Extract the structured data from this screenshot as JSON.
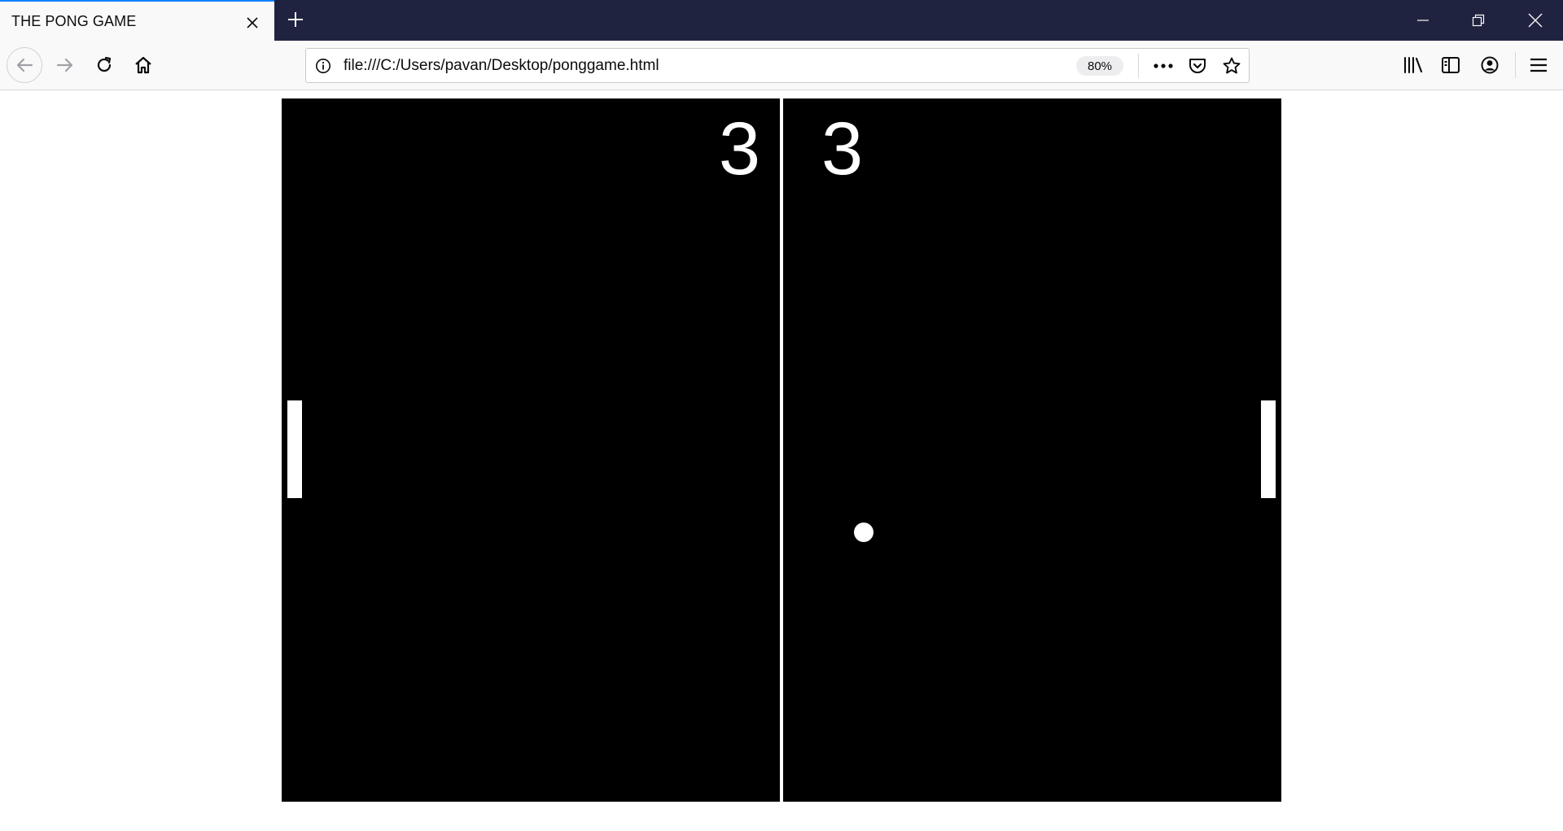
{
  "browser": {
    "tab": {
      "title": "THE PONG GAME"
    },
    "icons": {
      "tab_close": "close-icon",
      "new_tab": "plus-icon",
      "minimize": "minimize-icon",
      "restore": "restore-icon",
      "window_close": "close-icon",
      "back": "arrow-left-icon",
      "forward": "arrow-right-icon",
      "reload": "reload-icon",
      "home": "home-icon",
      "site_info": "info-icon",
      "page_actions": "ellipsis-icon",
      "pocket": "pocket-icon",
      "bookmark": "star-icon",
      "library": "library-icon",
      "sidebar": "sidebar-icon",
      "account": "account-icon",
      "menu": "hamburger-icon"
    },
    "url": "file:///C:/Users/pavan/Desktop/ponggame.html",
    "zoom": "80%",
    "colors": {
      "titlebar": "#202340",
      "tab_accent": "#0a84ff",
      "toolbar": "#f9f9fa"
    }
  },
  "game": {
    "score_left": "3",
    "score_right": "3",
    "colors": {
      "background": "#000000",
      "foreground": "#ffffff"
    }
  }
}
